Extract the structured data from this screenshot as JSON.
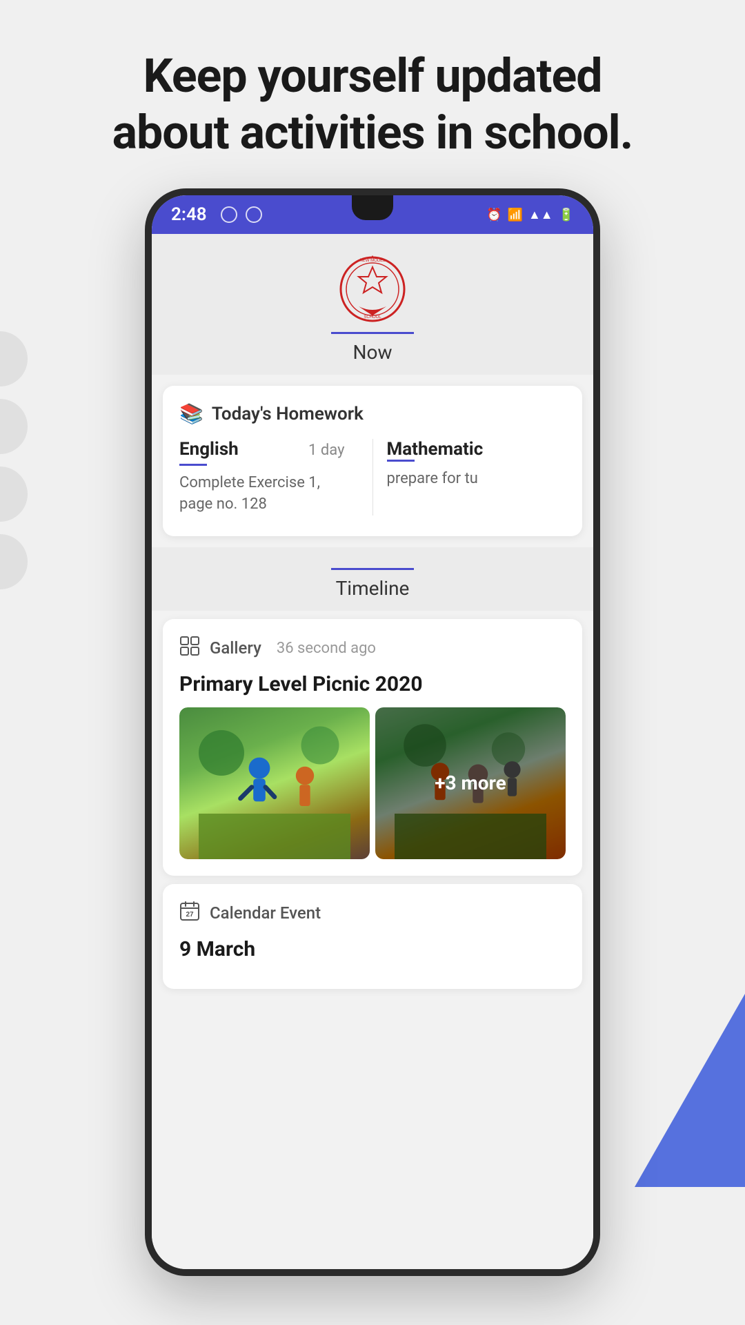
{
  "page": {
    "header": {
      "line1": "Keep yourself updated",
      "line2": "about activities in school."
    }
  },
  "status_bar": {
    "time": "2:48",
    "right_icons": "⏰ 📶 📶 🔋"
  },
  "school": {
    "name": "NEW MODEL SECONDARY SCHOOL",
    "tab_label": "Now"
  },
  "homework": {
    "section_icon": "📚",
    "section_title": "Today's Homework",
    "subjects": [
      {
        "name": "English",
        "days": "1 day",
        "task": "Complete Exercise 1, page no. 128"
      },
      {
        "name": "Mathematic",
        "days": "",
        "task": "prepare for tu"
      }
    ]
  },
  "timeline": {
    "tab_label": "Timeline",
    "cards": [
      {
        "type": "Gallery",
        "type_icon": "🖼",
        "time": "36 second ago",
        "title": "Primary Level Picnic 2020",
        "more_count": "+3 more"
      },
      {
        "type": "Calendar Event",
        "type_icon": "📅",
        "time": "",
        "title": "9 March"
      }
    ]
  }
}
